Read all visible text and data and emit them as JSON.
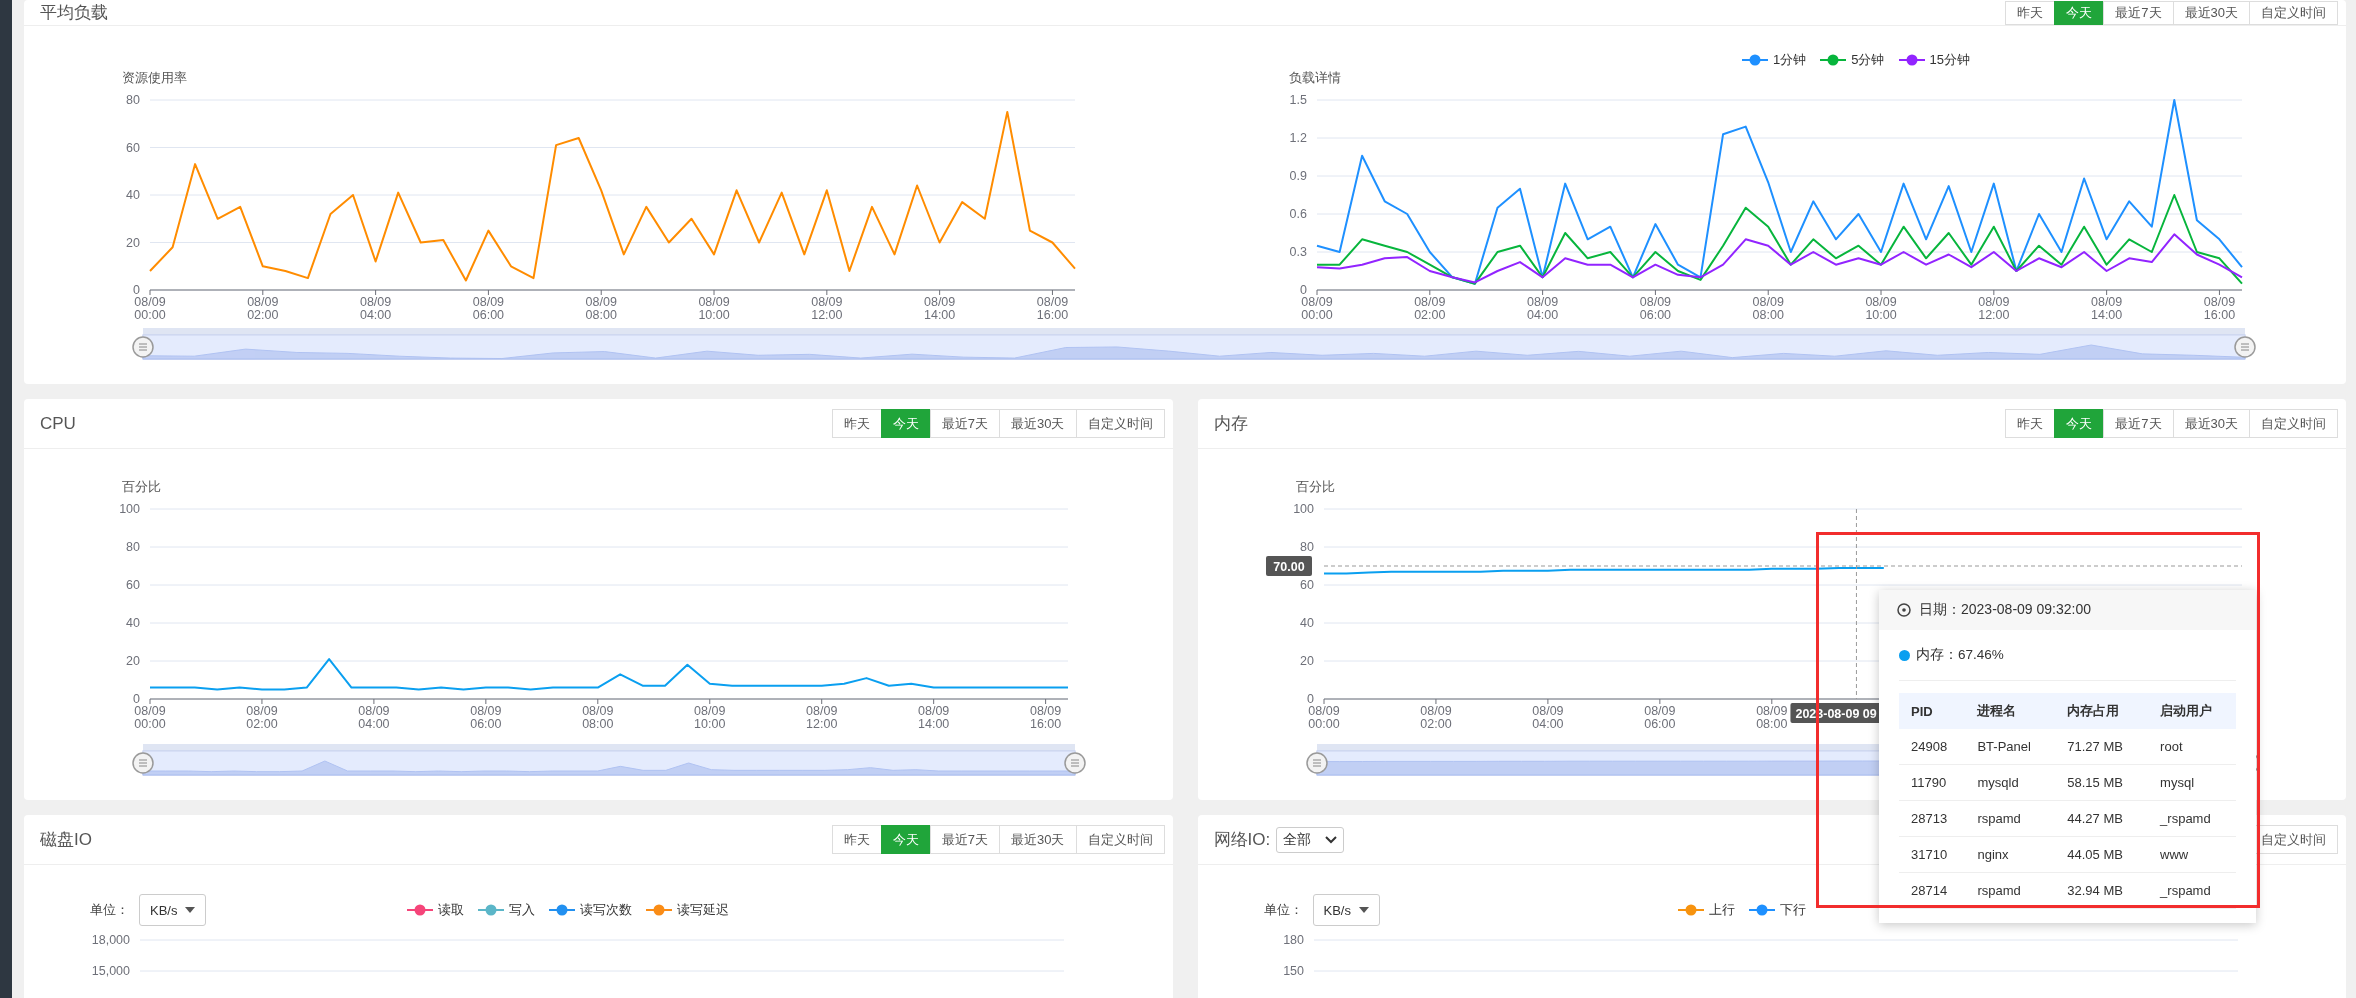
{
  "panels": [
    {
      "kind": "double",
      "title": "平均负载",
      "slider": {
        "level": 1
      },
      "buttons": [
        {
          "label": "昨天",
          "selected": false
        },
        {
          "label": "今天",
          "selected": true
        },
        {
          "label": "最近7天",
          "selected": false
        },
        {
          "label": "最近30天",
          "selected": false
        },
        {
          "label": "自定义时间",
          "selected": false
        }
      ],
      "charts": [
        {
          "chart_data": {
            "type": "line",
            "grid": true,
            "ylabel": "资源使用率",
            "ylim": [
              0,
              80
            ],
            "yticks": [
              0,
              20,
              40,
              60,
              80
            ],
            "categories": [
              "08/09 00:00",
              null,
              null,
              null,
              null,
              "08/09 02:00",
              null,
              null,
              null,
              null,
              "08/09 04:00",
              null,
              null,
              null,
              null,
              "08/09 06:00",
              null,
              null,
              null,
              null,
              "08/09 08:00",
              null,
              null,
              null,
              null,
              "08/09 10:00",
              null,
              null,
              null,
              null,
              "08/09 12:00",
              null,
              null,
              null,
              null,
              "08/09 14:00",
              null,
              null,
              null,
              null,
              "08/09 16:00",
              null
            ],
            "series": [
              {
                "color": "#ff8c00",
                "values": [
                  8,
                  18,
                  53,
                  30,
                  35,
                  10,
                  8,
                  5,
                  32,
                  40,
                  12,
                  41,
                  20,
                  21,
                  4,
                  25,
                  10,
                  5,
                  61,
                  64,
                  42,
                  15,
                  35,
                  20,
                  30,
                  15,
                  42,
                  20,
                  41,
                  15,
                  42,
                  8,
                  35,
                  15,
                  44,
                  20,
                  37,
                  30,
                  75,
                  25,
                  20,
                  9
                ]
              }
            ]
          }
        },
        {
          "chart_data": {
            "type": "line",
            "grid": true,
            "ylabel": "负载详情",
            "ylim": [
              0,
              1.5
            ],
            "yticks": [
              0,
              0.3,
              0.6,
              0.9,
              1.2,
              1.5
            ],
            "categories": [
              "08/09 00:00",
              null,
              null,
              null,
              null,
              "08/09 02:00",
              null,
              null,
              null,
              null,
              "08/09 04:00",
              null,
              null,
              null,
              null,
              "08/09 06:00",
              null,
              null,
              null,
              null,
              "08/09 08:00",
              null,
              null,
              null,
              null,
              "08/09 10:00",
              null,
              null,
              null,
              null,
              "08/09 12:00",
              null,
              null,
              null,
              null,
              "08/09 14:00",
              null,
              null,
              null,
              null,
              "08/09 16:00",
              null
            ],
            "series": [
              {
                "name": "1分钟",
                "color": "#1e90ff",
                "values": [
                  0.35,
                  0.3,
                  1.06,
                  0.7,
                  0.6,
                  0.3,
                  0.1,
                  0.05,
                  0.65,
                  0.8,
                  0.1,
                  0.84,
                  0.4,
                  0.5,
                  0.1,
                  0.52,
                  0.2,
                  0.1,
                  1.23,
                  1.29,
                  0.85,
                  0.3,
                  0.7,
                  0.4,
                  0.6,
                  0.3,
                  0.84,
                  0.4,
                  0.82,
                  0.3,
                  0.84,
                  0.15,
                  0.6,
                  0.3,
                  0.88,
                  0.4,
                  0.7,
                  0.5,
                  1.5,
                  0.55,
                  0.4,
                  0.18
                ]
              },
              {
                "name": "5分钟",
                "color": "#07b53c",
                "values": [
                  0.2,
                  0.2,
                  0.4,
                  0.35,
                  0.3,
                  0.2,
                  0.1,
                  0.05,
                  0.3,
                  0.35,
                  0.1,
                  0.45,
                  0.25,
                  0.3,
                  0.1,
                  0.3,
                  0.15,
                  0.08,
                  0.35,
                  0.65,
                  0.5,
                  0.2,
                  0.4,
                  0.25,
                  0.35,
                  0.2,
                  0.5,
                  0.25,
                  0.45,
                  0.2,
                  0.5,
                  0.15,
                  0.35,
                  0.2,
                  0.5,
                  0.2,
                  0.4,
                  0.3,
                  0.75,
                  0.3,
                  0.25,
                  0.05
                ]
              },
              {
                "name": "15分钟",
                "color": "#9224ff",
                "values": [
                  0.18,
                  0.17,
                  0.2,
                  0.25,
                  0.26,
                  0.15,
                  0.1,
                  0.06,
                  0.15,
                  0.22,
                  0.1,
                  0.25,
                  0.2,
                  0.2,
                  0.1,
                  0.2,
                  0.12,
                  0.1,
                  0.2,
                  0.4,
                  0.35,
                  0.2,
                  0.3,
                  0.2,
                  0.25,
                  0.2,
                  0.3,
                  0.2,
                  0.28,
                  0.18,
                  0.3,
                  0.15,
                  0.25,
                  0.18,
                  0.3,
                  0.15,
                  0.25,
                  0.22,
                  0.44,
                  0.28,
                  0.2,
                  0.1
                ]
              }
            ]
          }
        }
      ]
    },
    {
      "kind": "single",
      "title": "CPU",
      "slider": {
        "level": 1
      },
      "buttons": [
        {
          "label": "昨天",
          "selected": false
        },
        {
          "label": "今天",
          "selected": true
        },
        {
          "label": "最近7天",
          "selected": false
        },
        {
          "label": "最近30天",
          "selected": false
        },
        {
          "label": "自定义时间",
          "selected": false
        }
      ],
      "chart_data": {
        "type": "line",
        "grid": true,
        "ylabel": "百分比",
        "ylim": [
          0,
          100
        ],
        "yticks": [
          0,
          20,
          40,
          60,
          80,
          100
        ],
        "categories": [
          "08/09 00:00",
          null,
          null,
          null,
          null,
          "08/09 02:00",
          null,
          null,
          null,
          null,
          "08/09 04:00",
          null,
          null,
          null,
          null,
          "08/09 06:00",
          null,
          null,
          null,
          null,
          "08/09 08:00",
          null,
          null,
          null,
          null,
          "08/09 10:00",
          null,
          null,
          null,
          null,
          "08/09 12:00",
          null,
          null,
          null,
          null,
          "08/09 14:00",
          null,
          null,
          null,
          null,
          "08/09 16:00",
          null
        ],
        "series": [
          {
            "color": "#0a9ff0",
            "values": [
              6,
              6,
              6,
              5,
              6,
              5,
              5,
              6,
              21,
              6,
              6,
              6,
              5,
              6,
              5,
              6,
              6,
              5,
              6,
              6,
              6,
              13,
              7,
              7,
              18,
              8,
              7,
              7,
              7,
              7,
              7,
              8,
              11,
              7,
              8,
              6,
              6,
              6,
              6,
              6,
              6,
              6
            ]
          }
        ]
      }
    },
    {
      "kind": "single",
      "title": "内存",
      "slider": {
        "level": 1
      },
      "buttons": [
        {
          "label": "昨天",
          "selected": false
        },
        {
          "label": "今天",
          "selected": true
        },
        {
          "label": "最近7天",
          "selected": false
        },
        {
          "label": "最近30天",
          "selected": false
        },
        {
          "label": "自定义时间",
          "selected": false
        }
      ],
      "chart_data": {
        "type": "line",
        "grid": true,
        "ylabel": "百分比",
        "ylim": [
          0,
          100
        ],
        "yticks": [
          0,
          20,
          40,
          60,
          80,
          100
        ],
        "categories": [
          "08/09 00:00",
          null,
          null,
          null,
          null,
          "08/09 02:00",
          null,
          null,
          null,
          null,
          "08/09 04:00",
          null,
          null,
          null,
          null,
          "08/09 06:00",
          null,
          null,
          null,
          null,
          "08/09 08:00",
          null,
          null,
          null,
          null,
          null,
          null,
          null,
          null,
          null,
          null,
          null,
          null,
          null,
          null,
          null,
          null,
          null,
          null,
          null,
          null,
          null
        ],
        "series": [
          {
            "color": "#0a9ff0",
            "values": [
              66,
              66,
              66.5,
              67,
              67,
              67,
              67,
              67,
              67.5,
              67.5,
              67.5,
              68,
              68,
              68,
              68,
              68,
              68,
              68,
              68,
              68,
              68.5,
              68.5,
              68.5,
              69,
              69,
              69,
              null,
              null,
              null,
              null,
              null,
              null,
              null,
              null,
              null,
              null,
              null,
              null,
              null,
              null,
              null,
              null
            ]
          }
        ],
        "ref_lines": [
          {
            "axis": "y",
            "value": 70,
            "label": "70.00"
          }
        ],
        "annotations": [
          "2023-08-09 09"
        ]
      }
    },
    {
      "kind": "io",
      "title": "磁盘IO",
      "buttons": [
        {
          "label": "昨天",
          "selected": false
        },
        {
          "label": "今天",
          "selected": true
        },
        {
          "label": "最近7天",
          "selected": false
        },
        {
          "label": "最近30天",
          "selected": false
        },
        {
          "label": "自定义时间",
          "selected": false
        }
      ],
      "unit_label": "单位：",
      "unit": "KB/s",
      "chart_data": {
        "type": "line",
        "ylim": [
          15000,
          18000
        ],
        "yticks": [
          {
            "value": 18000,
            "label": "18,000"
          },
          {
            "value": 15000,
            "label": "15,000"
          }
        ],
        "series": [
          {
            "name": "读取",
            "color": "#f5457a"
          },
          {
            "name": "写入",
            "color": "#5bb6c8"
          },
          {
            "name": "读写次数",
            "color": "#2290f0"
          },
          {
            "name": "读写延迟",
            "color": "#fa8c16"
          }
        ]
      }
    },
    {
      "kind": "io",
      "title": "网络IO:",
      "filter": "全部",
      "buttons": [
        {
          "label": "自定义时间",
          "selected": false
        }
      ],
      "unit_label": "单位：",
      "unit": "KB/s",
      "chart_data": {
        "type": "line",
        "ylim": [
          150,
          180
        ],
        "yticks": [
          180,
          150
        ],
        "series": [
          {
            "name": "上行",
            "color": "#f7930f"
          },
          {
            "name": "下行",
            "color": "#1e90ff"
          }
        ]
      }
    }
  ],
  "tooltip": {
    "date": "日期：2023-08-09 09:32:00",
    "value": "内存：67.46%",
    "columns": [
      "PID",
      "进程名",
      "内存占用",
      "启动用户"
    ],
    "rows": [
      [
        "24908",
        "BT-Panel",
        "71.27 MB",
        "root"
      ],
      [
        "11790",
        "mysqld",
        "58.15 MB",
        "mysql"
      ],
      [
        "28713",
        "rspamd",
        "44.27 MB",
        "_rspamd"
      ],
      [
        "31710",
        "nginx",
        "44.05 MB",
        "www"
      ],
      [
        "28714",
        "rspamd",
        "32.94 MB",
        "_rspamd"
      ]
    ]
  }
}
